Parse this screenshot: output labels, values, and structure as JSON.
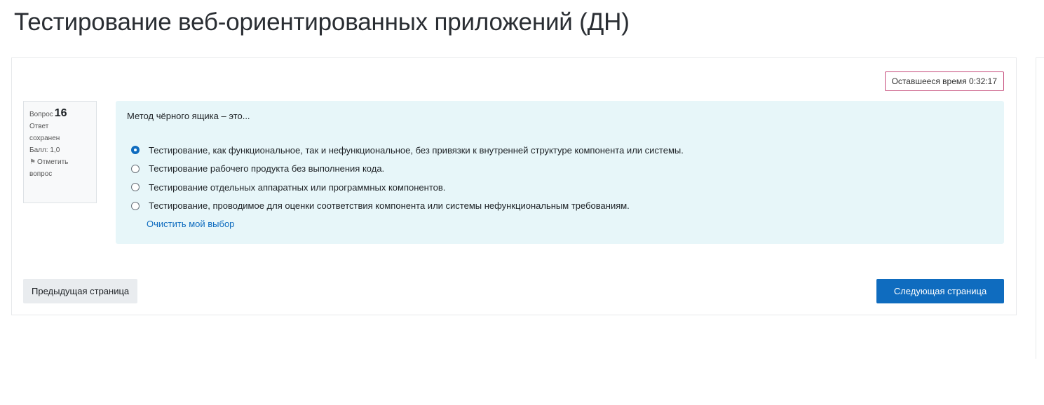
{
  "page": {
    "title": "Тестирование веб-ориентированных приложений (ДН)"
  },
  "timer": {
    "label": "Оставшееся время 0:32:17"
  },
  "question_info": {
    "number_label": "Вопрос",
    "number": "16",
    "state_line1": "Ответ",
    "state_line2": "сохранен",
    "grade": "Балл: 1,0",
    "flag_line1": "Отметить",
    "flag_line2": "вопрос"
  },
  "question": {
    "text": "Метод чёрного ящика – это...",
    "answers": [
      {
        "text": "Тестирование, как функциональное, так и нефункциональное, без привязки к внутренней структуре компонента или системы.",
        "checked": true
      },
      {
        "text": "Тестирование рабочего продукта без выполнения кода.",
        "checked": false
      },
      {
        "text": "Тестирование отдельных аппаратных или программных компонентов.",
        "checked": false
      },
      {
        "text": "Тестирование, проводимое для оценки соответствия компонента или системы нефункциональным требованиям.",
        "checked": false
      }
    ],
    "clear_label": "Очистить мой выбор"
  },
  "navigation": {
    "prev_label": "Предыдущая страница",
    "next_label": "Следующая страница"
  },
  "colors": {
    "accent": "#0f6cbf",
    "question_bg": "#e7f6f9",
    "timer_border": "#c54b7a"
  }
}
